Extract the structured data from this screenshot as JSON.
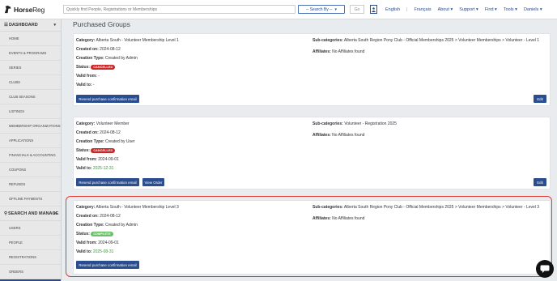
{
  "brand": {
    "name_bold": "Horse",
    "name_reg": "Reg"
  },
  "search": {
    "placeholder": "Quickly find People, Registrations or Memberships"
  },
  "searchby": {
    "label": "-- Search By --",
    "caret": "▾"
  },
  "go_label": "Go",
  "nav": {
    "english": "English",
    "sep": "|",
    "francais": "Français",
    "about": "About ▾",
    "support": "Support ▾",
    "find": "Find ▾",
    "tools": "Tools ▾",
    "user": "Daniels ▾"
  },
  "sidebar": {
    "dashboard_title": "DASHBOARD",
    "dashboard_caret": "▾",
    "dashboard_items": [
      "HOME",
      "EVENTS & PROGRAMS",
      "SERIES",
      "CLUBS",
      "CLUB SEASONS",
      "LISTINGS",
      "MEMBERSHIP ORGANIZATIONS",
      "APPLICATIONS",
      "FINANCIALS & ACCOUNTING",
      "COUPONS",
      "REFUNDS",
      "OFFLINE PAYMENTS"
    ],
    "search_title": "SEARCH AND MANAGE",
    "search_caret": "▾",
    "search_items": [
      "USERS",
      "PEOPLE",
      "REGISTRATIONS",
      "ORDERS"
    ]
  },
  "main": {
    "title": "Purchased Groups"
  },
  "labels": {
    "category": "Category:",
    "created_on": "Created on:",
    "creation_type": "Creation Type:",
    "status": "Status:",
    "valid_from": "Valid from:",
    "valid_to": "Valid to:",
    "subcategories": "Sub-categories:",
    "affiliates": "Affiliates:"
  },
  "groups": [
    {
      "category": "Alberta South - Volunteer Membership Level 1",
      "created_on": "2024-08-12",
      "creation_type": "Created by Admin",
      "status": "CANCELLED",
      "valid_from": "-",
      "valid_to": "-",
      "subcategories": "Alberta South Region Pony Club - Official Memberships 2025 > Volunteer Memberships > Volunteer - Level 1",
      "affiliates": "No Affiliates found",
      "resend_label": "Resend purchase confirmation email",
      "edit_label": "Edit"
    },
    {
      "category": "Volunteer Member",
      "created_on": "2024-08-12",
      "creation_type": "Created by User",
      "status": "CANCELLED",
      "valid_from": "2024-09-01",
      "valid_to": "2025-12-31",
      "subcategories": "Volunteer - Registration 2025",
      "affiliates": "No Affiliates found",
      "resend_label": "Resend purchase confirmation email",
      "view_order_label": "View Order",
      "edit_label": "Edit"
    },
    {
      "category": "Alberta South - Volunteer Membership Level 3",
      "created_on": "2024-08-12",
      "creation_type": "Created by Admin",
      "status": "COMPLETE",
      "valid_from": "2024-09-01",
      "valid_to": "2025-08-31",
      "subcategories": "Alberta South Region Pony Club - Official Memberships 2025 > Volunteer Memberships > Volunteer - Level 3",
      "affiliates": "No Affiliates found",
      "resend_label": "Resend purchase confirmation email"
    }
  ],
  "colors": {
    "primary": "#2a4d8f",
    "cancelled": "#c62828",
    "complete": "#6cc06c",
    "highlight": "#e53935"
  }
}
